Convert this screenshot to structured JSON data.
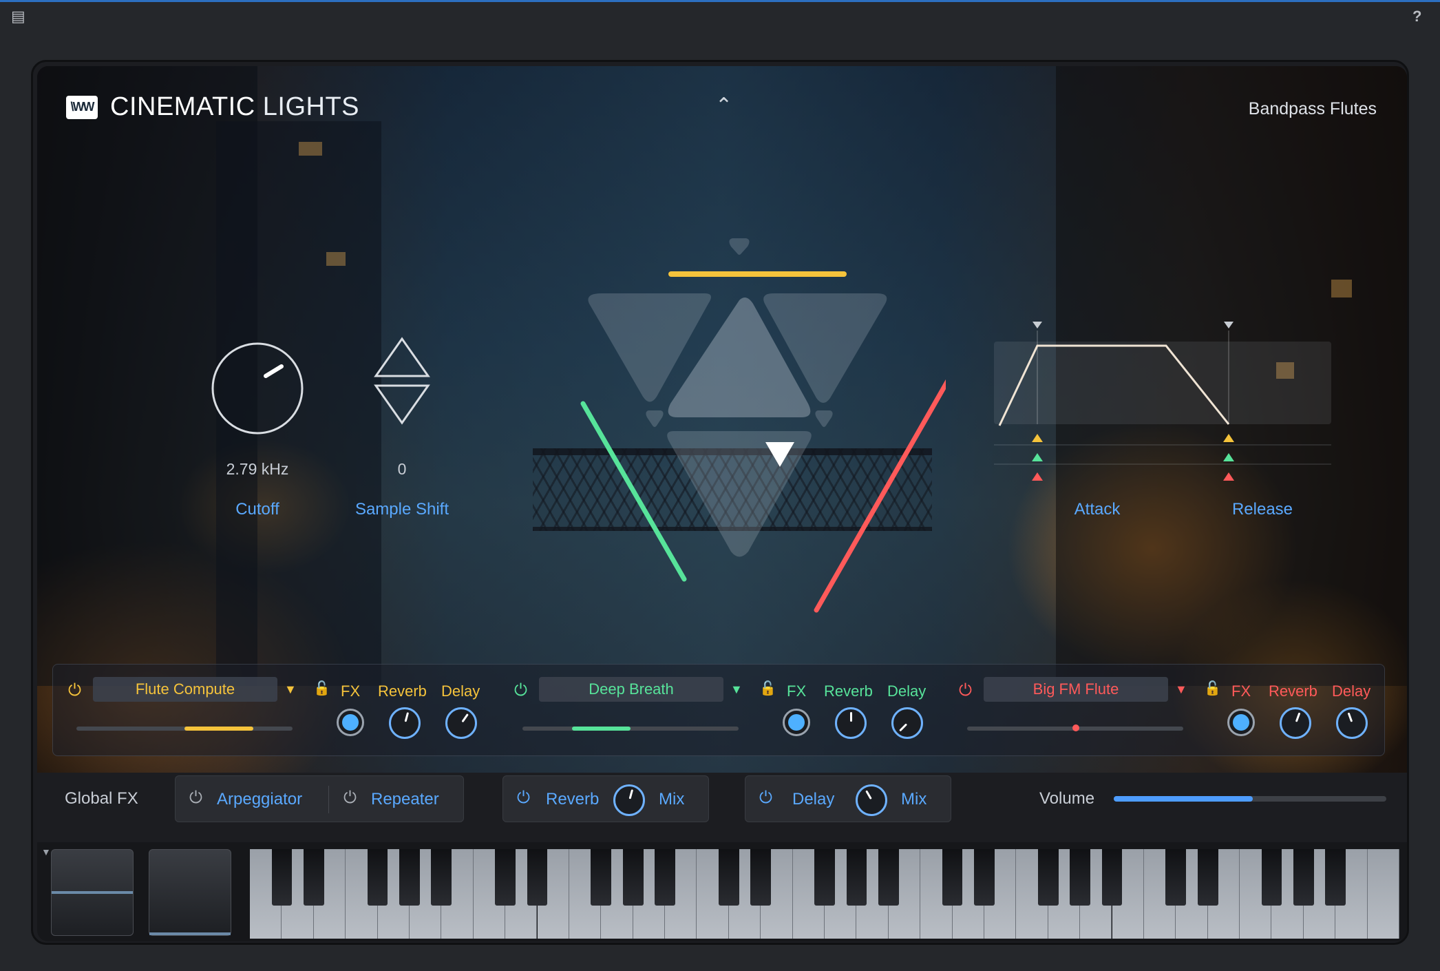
{
  "window": {
    "menu_icon": "document-icon",
    "help_label": "?"
  },
  "brand": {
    "logo_text": "\\WW",
    "name_bold": "CINEMATIC",
    "name_light": "LIGHTS"
  },
  "preset_name": "Bandpass Flutes",
  "controls": {
    "cutoff": {
      "value": "2.79 kHz",
      "label": "Cutoff",
      "angle_deg": 60
    },
    "sample_shift": {
      "value": "0",
      "label": "Sample Shift"
    },
    "attack": {
      "label": "Attack"
    },
    "release": {
      "label": "Release"
    }
  },
  "colors": {
    "accent": "#5aa9ff",
    "layer1": "#f5c33b",
    "layer2": "#57e39a",
    "layer3": "#ff5a5a"
  },
  "layers": [
    {
      "preset": "Flute Compute",
      "fx": "FX",
      "reverb": "Reverb",
      "delay": "Delay",
      "color": "#f5c33b",
      "fill_start": 0.5,
      "fill_end": 0.82
    },
    {
      "preset": "Deep Breath",
      "fx": "FX",
      "reverb": "Reverb",
      "delay": "Delay",
      "color": "#57e39a",
      "fill_start": 0.23,
      "fill_end": 0.5
    },
    {
      "preset": "Big FM Flute",
      "fx": "FX",
      "reverb": "Reverb",
      "delay": "Delay",
      "color": "#ff5a5a",
      "fill_start": 0.5,
      "fill_end": 0.5
    }
  ],
  "global": {
    "label": "Global FX",
    "arpeggiator": "Arpeggiator",
    "repeater": "Repeater",
    "reverb": "Reverb",
    "reverb_mix": "Mix",
    "delay": "Delay",
    "delay_mix": "Mix",
    "volume_label": "Volume",
    "volume_level": 0.51
  }
}
